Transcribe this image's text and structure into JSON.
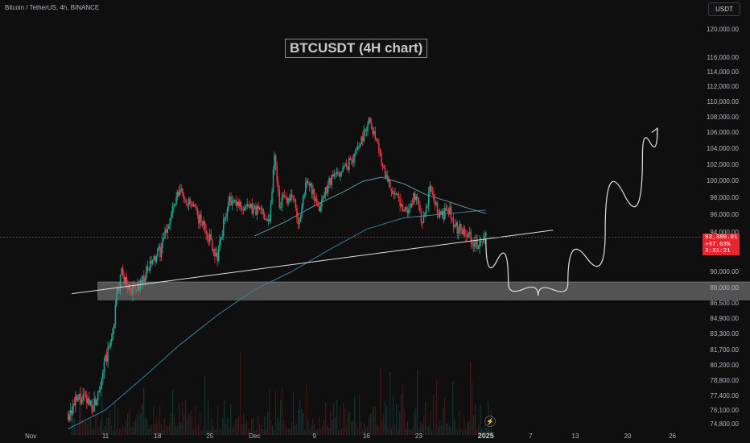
{
  "header": {
    "symbol_info": "Bitcoin / TetherUS, 4h, BINANCE",
    "currency_button": "USDT"
  },
  "current_price": {
    "price": "93,380.01",
    "change": "+97.63%",
    "countdown": "3:31:21"
  },
  "icons": {
    "lightning": "lightning-icon"
  },
  "colors": {
    "background": "#0f0f0f",
    "up": "#22ab94",
    "down": "#f23645",
    "ma_fast": "#5b9ca8",
    "ma_slow": "#3a7d99",
    "trendline": "#e0e0e0",
    "price_line": "#e3262f"
  },
  "chart_data": {
    "type": "candlestick",
    "title": "BTCUSDT (4H chart)",
    "xlabel": "",
    "ylabel": "",
    "ylim": [
      74000,
      122500
    ],
    "y_ticks": [
      "120,000.00",
      "116,000.00",
      "114,000.00",
      "112,000.00",
      "110,000.00",
      "108,000.00",
      "106,000.00",
      "104,000.00",
      "102,000.00",
      "100,000.00",
      "98,000.00",
      "96,000.00",
      "94,000.00",
      "90,000.00",
      "88,000.00",
      "86,500.00",
      "84,900.00",
      "83,300.00",
      "81,700.00",
      "80,200.00",
      "78,800.00",
      "77,400.00",
      "76,100.00",
      "74,800.00"
    ],
    "y_tick_values": [
      120000,
      116000,
      114000,
      112000,
      110000,
      108000,
      106000,
      104000,
      102000,
      100000,
      98000,
      96000,
      94000,
      90000,
      88000,
      86500,
      84900,
      83300,
      81700,
      80200,
      78800,
      77400,
      76100,
      74800
    ],
    "x_ticks": [
      "Nov",
      "11",
      "18",
      "25",
      "Dec",
      "9",
      "16",
      "23",
      "2025",
      "7",
      "13",
      "20",
      "26"
    ],
    "x_tick_days": [
      -10,
      0,
      7,
      14,
      20,
      28,
      35,
      42,
      51,
      57,
      63,
      70,
      76
    ],
    "x_axis_note": "days since 11 Nov 2024",
    "price_path_days": [
      -5,
      -3.5,
      -1.5,
      0,
      0.8,
      1.5,
      2.2,
      3,
      4,
      6,
      7.5,
      9,
      10,
      10.8,
      12,
      13.5,
      15,
      16.5,
      18,
      19.5,
      21,
      22,
      22.7,
      23.3,
      25,
      26,
      27,
      28.5,
      30,
      31.8,
      33,
      34.5,
      35.3,
      35.7,
      36.5,
      37.5,
      39,
      40.5,
      41.7,
      42.5,
      43.5,
      44.5,
      45.3,
      46,
      47,
      48,
      49,
      50,
      51
    ],
    "price_path_close": [
      75800,
      77100,
      76600,
      80500,
      82600,
      86900,
      89800,
      88100,
      87600,
      90500,
      92300,
      96500,
      98800,
      97700,
      96400,
      94200,
      91500,
      97500,
      97000,
      96600,
      96400,
      95300,
      103400,
      97300,
      98300,
      94800,
      100500,
      96400,
      100000,
      101300,
      102500,
      105500,
      107600,
      106900,
      104200,
      101000,
      97700,
      96400,
      98500,
      94300,
      99000,
      96200,
      95900,
      96500,
      94500,
      94300,
      93600,
      92400,
      93380
    ],
    "ma_fast_days": [
      20,
      24,
      28,
      32,
      34.5,
      37,
      40,
      43,
      46,
      49,
      51
    ],
    "ma_fast_values": [
      93600,
      95100,
      97000,
      98700,
      99900,
      100400,
      99600,
      98300,
      97500,
      96600,
      96100
    ],
    "ma_slow_days": [
      -5,
      0,
      5,
      10,
      15,
      20,
      25,
      30,
      35,
      40,
      45,
      51
    ],
    "ma_slow_values": [
      74300,
      76100,
      79000,
      82200,
      85200,
      87800,
      90000,
      92200,
      94300,
      95600,
      96000,
      96500
    ],
    "volume_note": "volume histogram (relative)",
    "annotations": {
      "support_zone": {
        "low": 86800,
        "high": 88700,
        "start_day": -1,
        "end_day": 87
      },
      "trendline": {
        "start_day": -4.5,
        "start_price": 87400,
        "end_day": 60,
        "end_price": 94200
      },
      "projection_path_days": [
        51,
        54,
        58,
        62,
        67,
        72,
        74
      ],
      "projection_path_price": [
        93380,
        88600,
        87200,
        88500,
        94000,
        103000,
        106500
      ]
    },
    "grid": false,
    "legend": "none"
  }
}
